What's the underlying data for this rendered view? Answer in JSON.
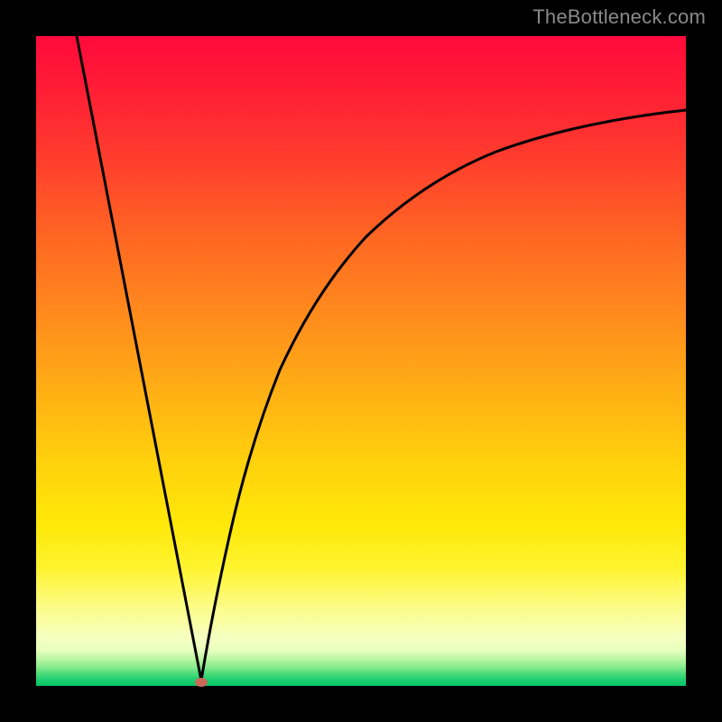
{
  "watermark": "TheBottleneck.com",
  "colors": {
    "gradient_top": "#ff0a3c",
    "gradient_mid": "#ffd20c",
    "gradient_bottom": "#07c468",
    "curve": "#000000",
    "marker": "#cc6a5a",
    "frame": "#000000",
    "watermark_text": "#8a8a8a"
  },
  "chart_data": {
    "type": "line",
    "title": "",
    "xlabel": "",
    "ylabel": "",
    "xlim": [
      0,
      100
    ],
    "ylim": [
      0,
      100
    ],
    "grid": false,
    "legend": false,
    "series": [
      {
        "name": "bottleneck-curve",
        "x": [
          6,
          10,
          15,
          20,
          25,
          27,
          30,
          35,
          40,
          45,
          50,
          55,
          60,
          65,
          70,
          75,
          80,
          85,
          90,
          95,
          100
        ],
        "y": [
          100,
          79,
          53,
          27,
          1,
          1,
          23,
          48,
          62,
          71,
          77,
          81,
          84,
          86,
          87,
          88,
          89,
          89,
          90,
          90,
          90
        ]
      }
    ],
    "annotations": [
      {
        "name": "optimal-point",
        "x": 25.4,
        "y": 0.5
      }
    ],
    "background_gradient": {
      "direction": "vertical",
      "stops": [
        {
          "pos": 0.0,
          "color": "#ff0a3c"
        },
        {
          "pos": 0.32,
          "color": "#ff6a22"
        },
        {
          "pos": 0.66,
          "color": "#ffd20c"
        },
        {
          "pos": 0.88,
          "color": "#fcfc8a"
        },
        {
          "pos": 0.96,
          "color": "#b6f5a0"
        },
        {
          "pos": 1.0,
          "color": "#07c468"
        }
      ]
    }
  }
}
